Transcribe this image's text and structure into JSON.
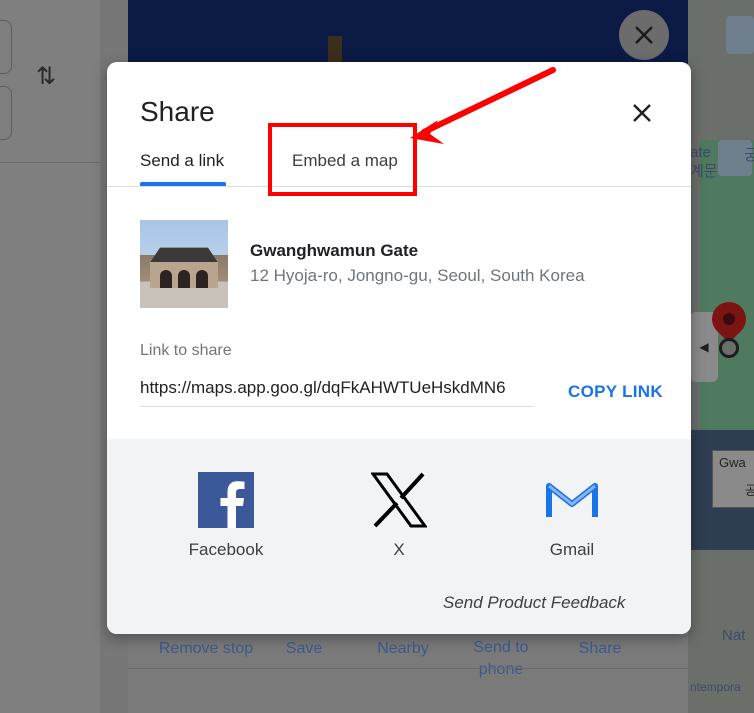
{
  "background": {
    "map_labels": [
      "ate",
      "궁",
      "계문",
      "Gwa",
      "공",
      "Nat",
      "ntempora"
    ],
    "actions": [
      "Remove stop",
      "Save",
      "Nearby",
      "Send to phone",
      "Share"
    ]
  },
  "modal": {
    "title": "Share",
    "tabs": [
      {
        "label": "Send a link",
        "active": true
      },
      {
        "label": "Embed a map",
        "active": false
      }
    ],
    "place": {
      "name": "Gwanghwamun Gate",
      "address": "12 Hyoja-ro, Jongno-gu, Seoul, South Korea"
    },
    "link_label": "Link to share",
    "link_value": "https://maps.app.goo.gl/dqFkAHWTUeHskdMN6",
    "copy_label": "COPY LINK",
    "share_targets": [
      {
        "label": "Facebook",
        "icon": "facebook-icon",
        "color": "#3b5998"
      },
      {
        "label": "X",
        "icon": "x-icon",
        "color": "#000000"
      },
      {
        "label": "Gmail",
        "icon": "gmail-icon",
        "color": "#1a73e8"
      }
    ],
    "feedback_label": "Send Product Feedback"
  },
  "colors": {
    "accent": "#1a73e8",
    "annotation": "#ff0000"
  }
}
